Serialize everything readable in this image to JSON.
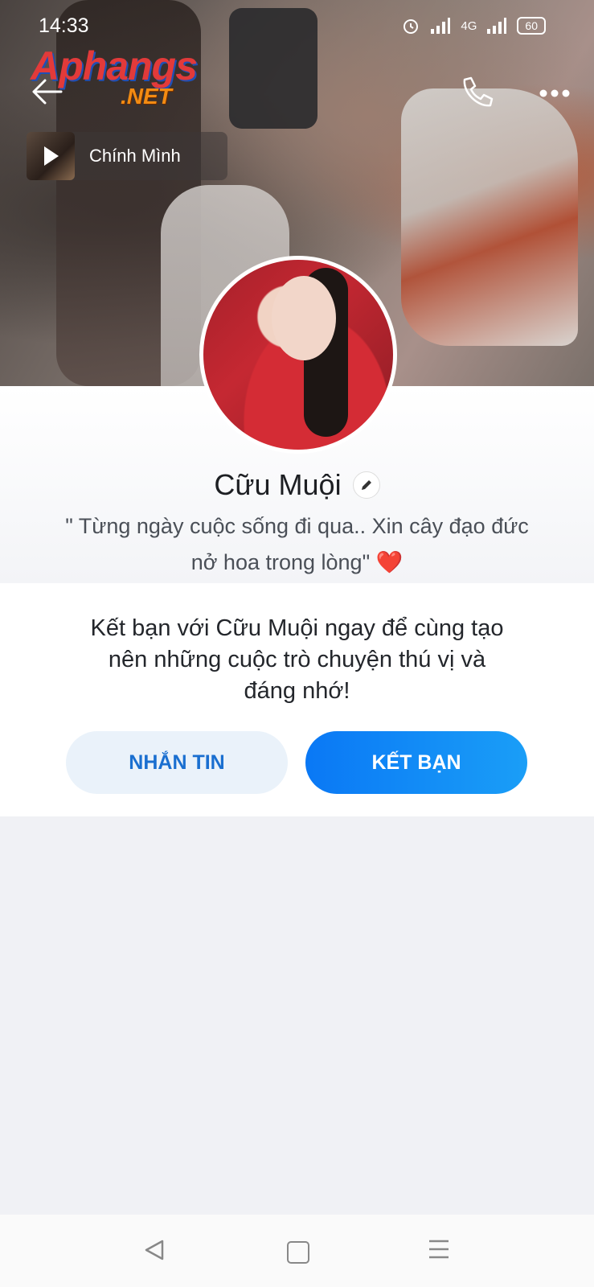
{
  "status_bar": {
    "time": "14:33",
    "network": "4G",
    "battery": "60"
  },
  "watermark": {
    "main": "Aphangs",
    "suffix": ".NET"
  },
  "header": {
    "back_icon": "arrow-left-icon",
    "call_icon": "phone-icon",
    "more_icon": "more-dots-icon"
  },
  "music": {
    "title": "Chính Mình"
  },
  "profile": {
    "name": "Cữu Muội",
    "bio_line1": "\" Từng ngày cuộc sống đi qua.. Xin cây đạo đức",
    "bio_line2": "nở hoa trong lòng\"",
    "bio_emoji": "❤️"
  },
  "friend_prompt": {
    "line1": "Kết bạn với Cữu Muội ngay để cùng tạo",
    "line2": "nên những cuộc trò chuyện thú vị và",
    "line3": "đáng nhớ!"
  },
  "actions": {
    "message_label": "NHẮN TIN",
    "add_friend_label": "KẾT BẠN"
  },
  "colors": {
    "accent": "#0a78f5",
    "message_bg": "#eaf2fa",
    "heart": "#e3242b"
  }
}
